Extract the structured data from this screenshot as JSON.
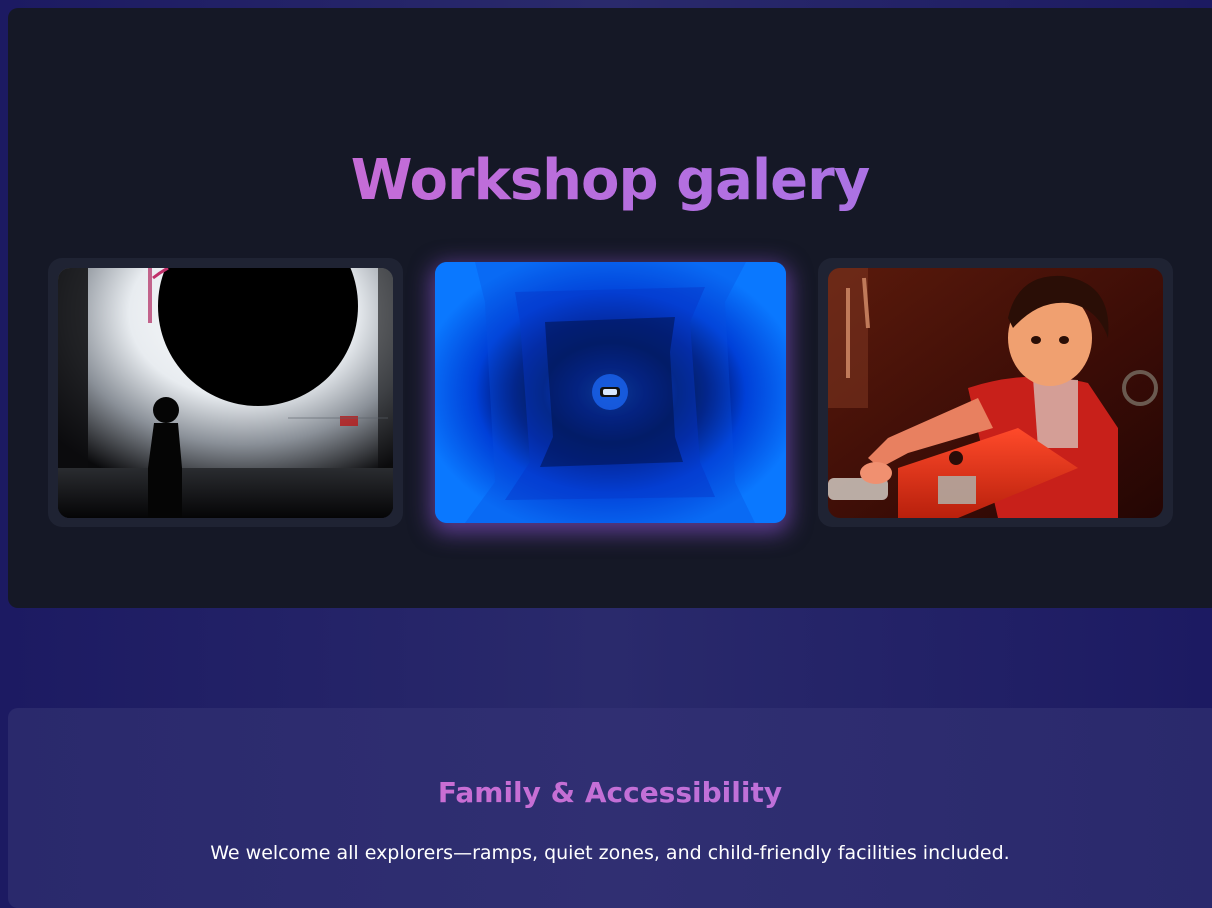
{
  "gallery": {
    "title": "Workshop galery",
    "images": [
      {
        "name": "eclipse-silhouette-photo",
        "subject": "child silhouette before glowing eclipse"
      },
      {
        "name": "blue-tunnel-photo",
        "subject": "blue light tunnel"
      },
      {
        "name": "child-red-exhibit-photo",
        "subject": "child at red interactive exhibit"
      }
    ]
  },
  "accessibility": {
    "title": "Family & Accessibility",
    "description": "We welcome all explorers—ramps, quiet zones, and child-friendly facilities included."
  },
  "colors": {
    "page_bg": "#22226a",
    "gallery_bg": "#151826",
    "card_bg": "#1f2333",
    "title_gradient_start": "#d868cc",
    "title_gradient_end": "#9c78ea",
    "featured_glow": "#9a5ae6"
  }
}
